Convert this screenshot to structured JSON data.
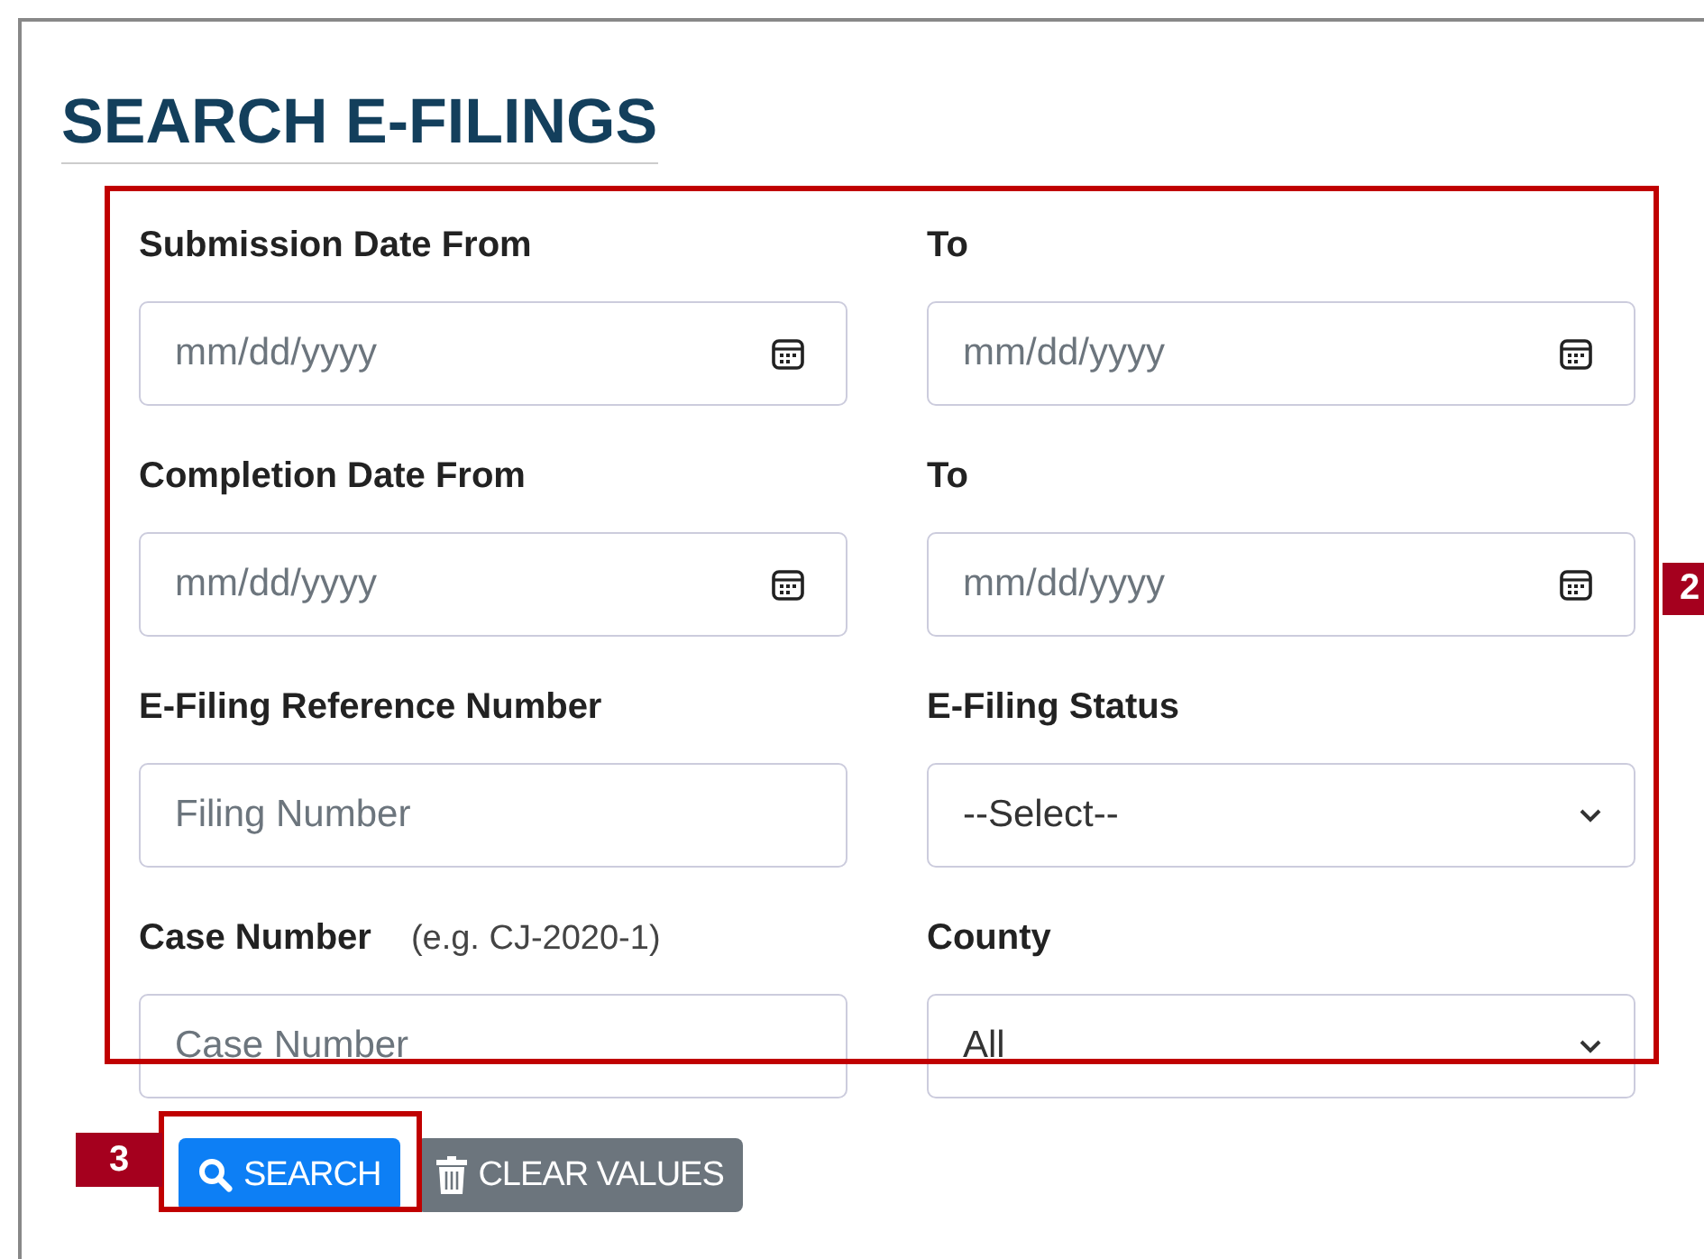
{
  "title": "SEARCH E-FILINGS",
  "fields": [
    {
      "label": "Submission Date From",
      "kind": "date",
      "placeholder": "mm/dd/yyyy"
    },
    {
      "label": "To",
      "kind": "date",
      "placeholder": "mm/dd/yyyy"
    },
    {
      "label": "Completion Date From",
      "kind": "date",
      "placeholder": "mm/dd/yyyy"
    },
    {
      "label": "To",
      "kind": "date",
      "placeholder": "mm/dd/yyyy"
    },
    {
      "label": "E-Filing Reference Number",
      "kind": "text",
      "placeholder": "Filing Number"
    },
    {
      "label": "E-Filing Status",
      "kind": "select",
      "value": "--Select--"
    },
    {
      "label": "Case Number",
      "hint": "(e.g. CJ-2020-1)",
      "kind": "text",
      "placeholder": "Case Number"
    },
    {
      "label": "County",
      "kind": "select",
      "value": "All"
    }
  ],
  "buttons": [
    {
      "label": "SEARCH",
      "kind": "primary"
    },
    {
      "label": "CLEAR VALUES",
      "kind": "secondary"
    }
  ],
  "callouts": [
    {
      "label": "2",
      "kind": "form"
    },
    {
      "label": "3",
      "kind": "search"
    }
  ]
}
